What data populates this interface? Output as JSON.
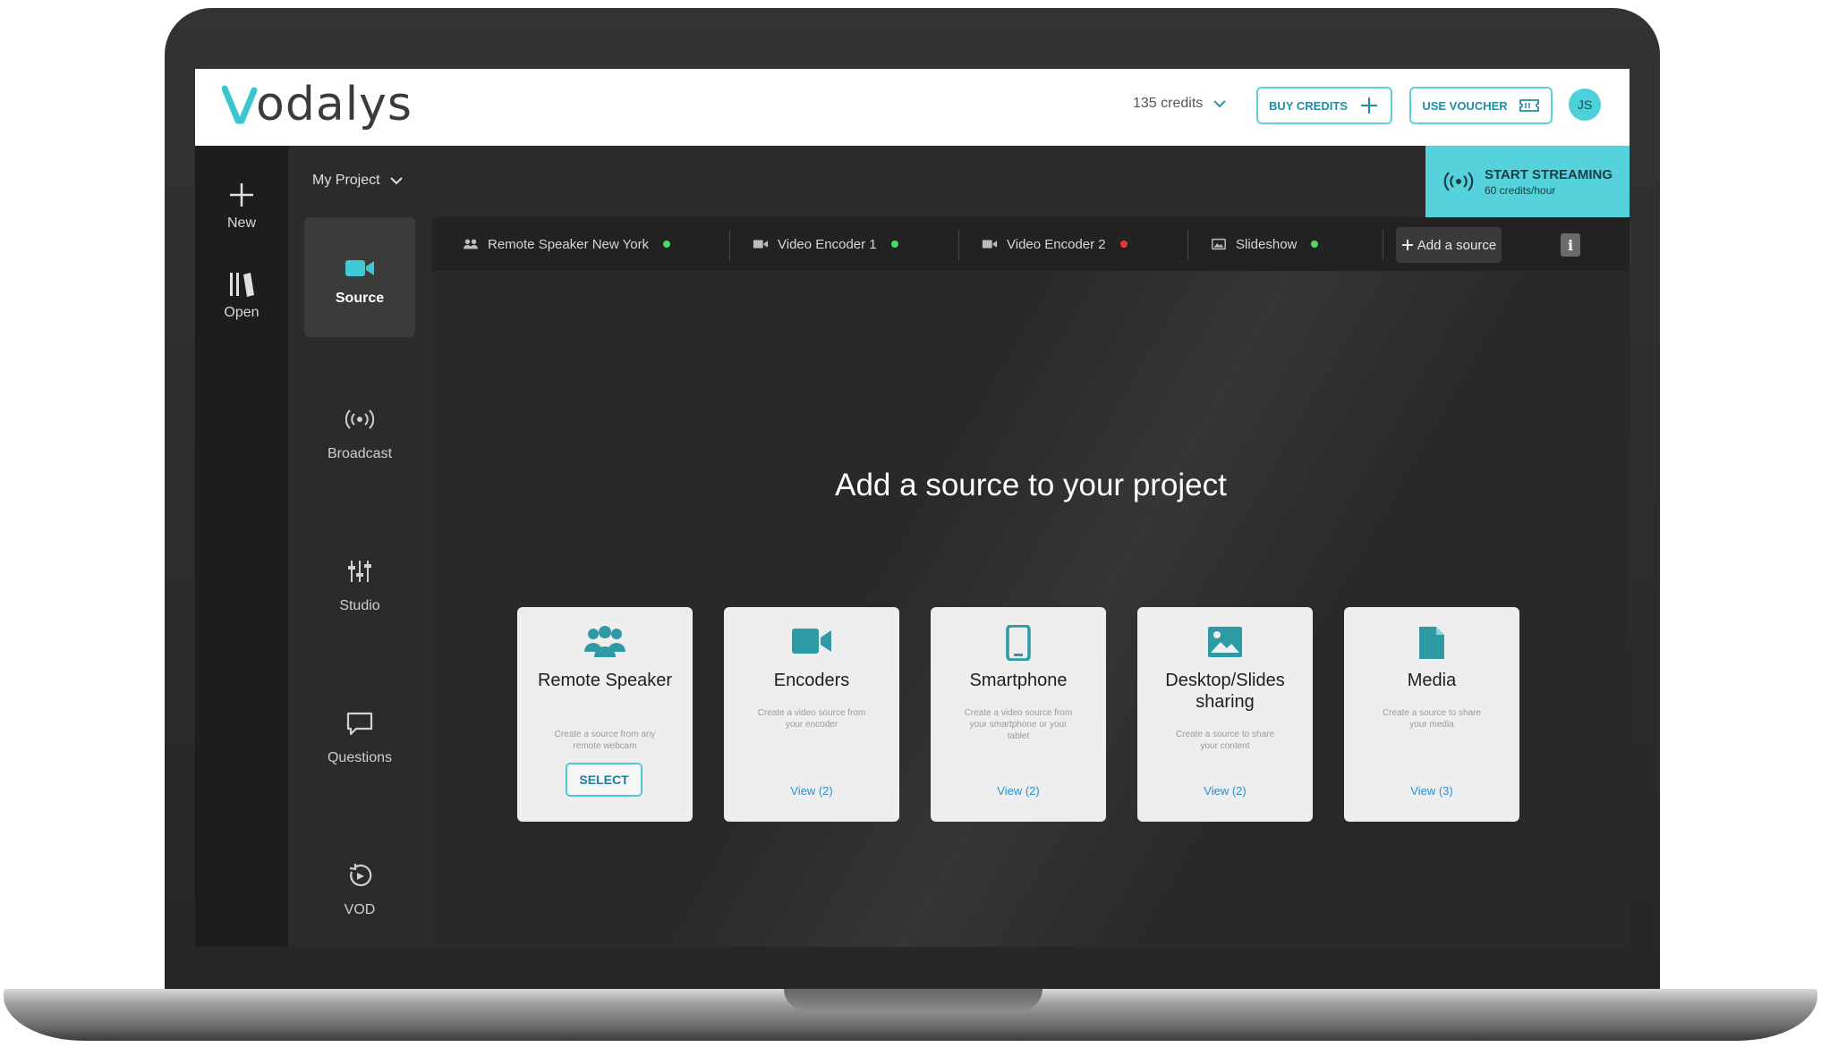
{
  "brand": {
    "logo_text": "odalys",
    "accent": "#55d2db"
  },
  "header": {
    "credits_label": "135 credits",
    "buy_credits_label": "BUY CREDITS",
    "use_voucher_label": "USE VOUCHER",
    "avatar_initials": "JS"
  },
  "rail": {
    "items": [
      {
        "label": "New",
        "icon": "plus-icon"
      },
      {
        "label": "Open",
        "icon": "library-icon"
      }
    ]
  },
  "project": {
    "name": "My Project"
  },
  "nav": {
    "items": [
      {
        "label": "Source",
        "icon": "video-camera-icon",
        "active": true
      },
      {
        "label": "Broadcast",
        "icon": "broadcast-icon",
        "active": false
      },
      {
        "label": "Studio",
        "icon": "sliders-icon",
        "active": false
      },
      {
        "label": "Questions",
        "icon": "chat-bubble-icon",
        "active": false
      },
      {
        "label": "VOD",
        "icon": "replay-icon",
        "active": false
      }
    ]
  },
  "stream": {
    "title": "START STREAMING",
    "subtitle": "60 credits/hour"
  },
  "tabs": [
    {
      "label": "Remote Speaker New York",
      "icon": "people-icon",
      "status_color": "#4cd964"
    },
    {
      "label": "Video Encoder 1",
      "icon": "video-camera-icon",
      "status_color": "#4cd964"
    },
    {
      "label": "Video Encoder 2",
      "icon": "video-camera-icon",
      "status_color": "#e53935"
    },
    {
      "label": "Slideshow",
      "icon": "image-icon",
      "status_color": "#4cd964"
    }
  ],
  "add_source_label": "Add a source",
  "info_label": "i",
  "main": {
    "heading": "Add a source to your project",
    "cards": [
      {
        "title": "Remote Speaker",
        "desc": "Create a source from any remote webcam",
        "action": "SELECT",
        "icon": "people-icon"
      },
      {
        "title": "Encoders",
        "desc": "Create a video source from your encoder",
        "action": "View (2)",
        "icon": "video-camera-icon"
      },
      {
        "title": "Smartphone",
        "desc": "Create a video source from your smartphone or your tablet",
        "action": "View (2)",
        "icon": "smartphone-icon"
      },
      {
        "title": "Desktop/Slides sharing",
        "desc": "Create a source to share your content",
        "action": "View (2)",
        "icon": "image-icon"
      },
      {
        "title": "Media",
        "desc": "Create a source to share your media",
        "action": "View (3)",
        "icon": "document-icon"
      }
    ]
  }
}
